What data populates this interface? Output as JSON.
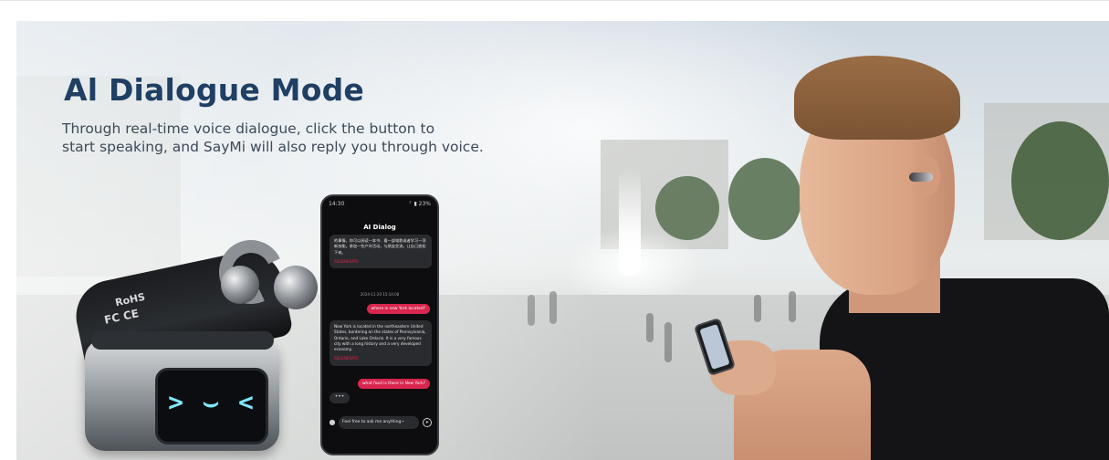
{
  "banner": {
    "title": "Al Dialogue Mode",
    "subtitle_line1": "Through real-time voice dialogue, click the button to",
    "subtitle_line2": "start speaking, and SayMi will also reply you through voice."
  },
  "case": {
    "marks": [
      "RoHS",
      "FC CE"
    ],
    "screen_face": ">  ⌣  <"
  },
  "phone": {
    "status_time": "14:30",
    "status_signal": "ᵀ  ▮ 23%",
    "screen_title": "AI Dialog",
    "messages": [
      {
        "role": "ai",
        "text": "的事情。你可以阅读一本书、看一部电影或者学习一项新技能。参加一些户外活动，与朋友交流。让自己放松下来。",
        "action": "REGENERATE"
      },
      {
        "role": "timestamp",
        "text": "2024-11-20 15:14:08"
      },
      {
        "role": "user",
        "text": "where is new York located?"
      },
      {
        "role": "ai",
        "text": "New York is located in the northeastern United States, bordering on the states of Pennsylvania, Ontario, and Lake Ontario. It is a very famous city with a long history and a very developed economy.",
        "action": "REGENERATE"
      },
      {
        "role": "user",
        "text": "what food is there in New York?"
      }
    ],
    "typing_indicator": "•••",
    "input_placeholder": "Feel free to ask me anything~"
  },
  "icons": {
    "mic": "mic-icon",
    "send": "send-icon"
  }
}
